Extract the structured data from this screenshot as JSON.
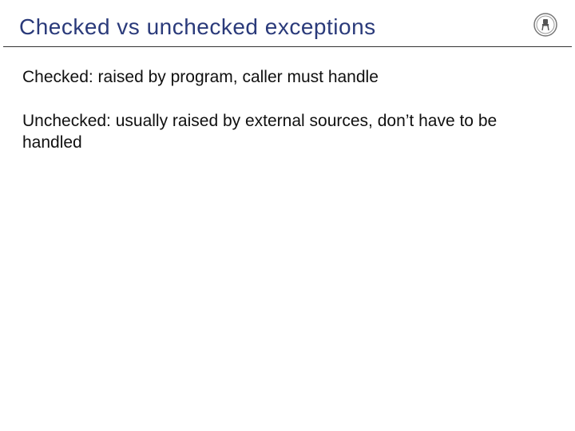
{
  "title": "Checked vs unchecked exceptions",
  "body": {
    "p1": "Checked: raised by program, caller must handle",
    "p2": "Unchecked: usually raised by external sources, don’t have to be handled"
  },
  "logo": {
    "name": "chair-logo"
  }
}
